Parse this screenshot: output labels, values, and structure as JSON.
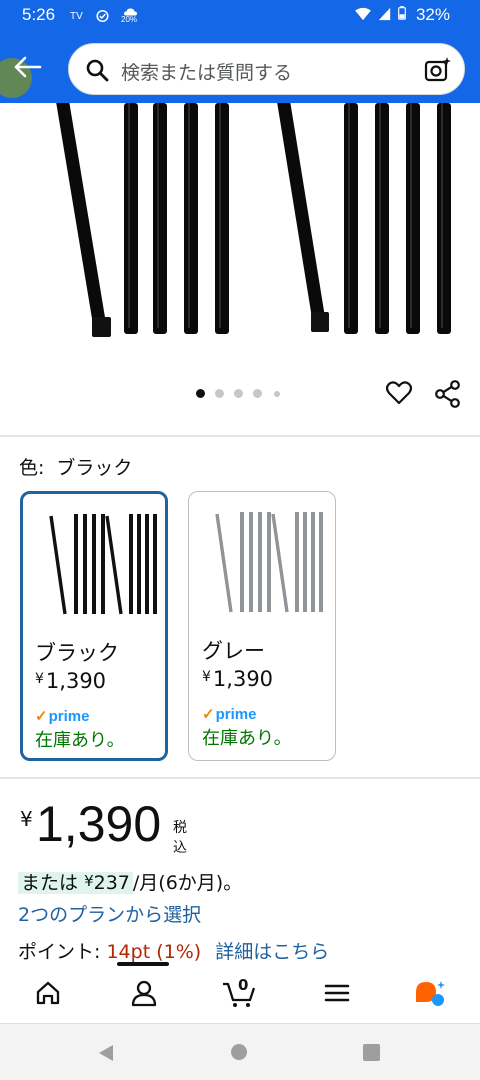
{
  "status_bar": {
    "time": "5:26",
    "small_label": "20%",
    "battery": "32%",
    "icons": [
      "tv-icon",
      "check-circle-icon",
      "weather-icon",
      "wifi-icon",
      "signal-icon",
      "battery-icon"
    ]
  },
  "header": {
    "back_icon": "arrow-left-icon",
    "search_placeholder": "検索または質問する",
    "search_icon": "search-icon",
    "camera_icon": "camera-search-icon",
    "accent_color": "#1468e8"
  },
  "gallery": {
    "image_count": 5,
    "active_index": 0,
    "actions": [
      "heart-icon",
      "share-icon"
    ]
  },
  "variation": {
    "label_key": "色:",
    "label_value": "ブラック",
    "options": [
      {
        "name": "ブラック",
        "price_yen": "¥",
        "price": "1,390",
        "prime": "prime",
        "stock": "在庫あり。",
        "selected": true,
        "color": "#111111"
      },
      {
        "name": "グレー",
        "price_yen": "¥",
        "price": "1,390",
        "prime": "prime",
        "stock": "在庫あり。",
        "selected": false,
        "color": "#8f9499"
      }
    ]
  },
  "price": {
    "yen": "¥",
    "amount": "1,390",
    "tax": "税込",
    "installment_prefix": "または",
    "installment_yen": "¥",
    "installment_amount": "237",
    "installment_suffix": "/月(6か月)。",
    "plans_link": "2つのプランから選択",
    "points_label": "ポイント:",
    "points_value": "14pt",
    "points_pct": "(1%)",
    "points_link": "詳細はこちら"
  },
  "bottom_nav": {
    "items": [
      "home-icon",
      "account-icon",
      "cart-icon",
      "menu-icon",
      "assistant-icon"
    ],
    "cart_count": "0"
  },
  "system_nav": {
    "items": [
      "back-triangle-icon",
      "home-circle-icon",
      "recents-square-icon"
    ]
  }
}
